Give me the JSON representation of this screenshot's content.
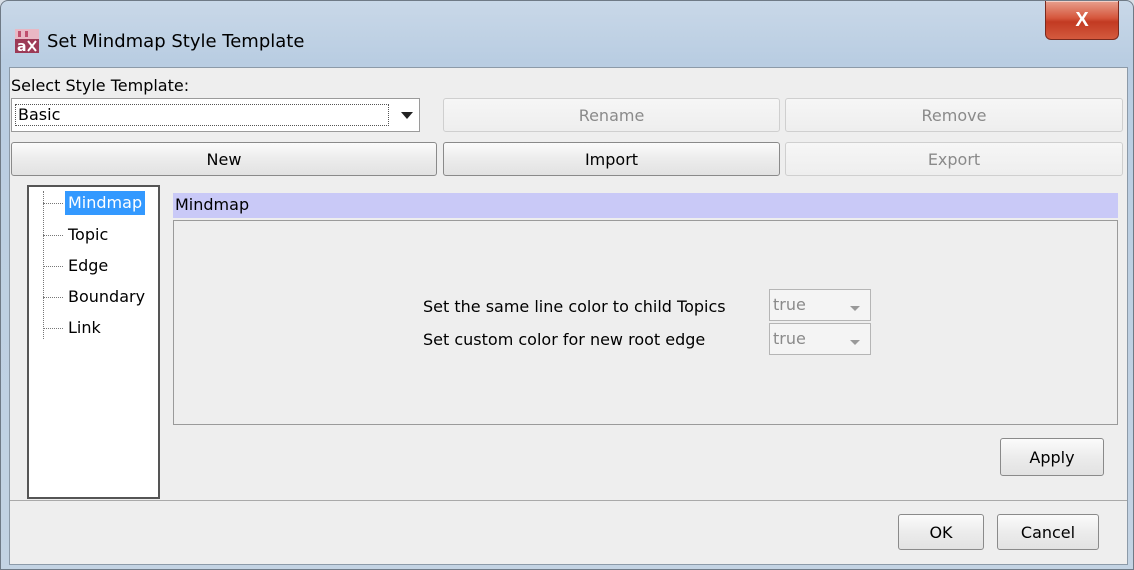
{
  "window": {
    "title": "Set Mindmap Style Template",
    "close_glyph": "X",
    "icon": "app-icon"
  },
  "template": {
    "label": "Select Style Template:",
    "selected": "Basic",
    "rename_label": "Rename",
    "remove_label": "Remove",
    "new_label": "New",
    "import_label": "Import",
    "export_label": "Export"
  },
  "tree": {
    "items": [
      "Mindmap",
      "Topic",
      "Edge",
      "Boundary",
      "Link"
    ],
    "selected_index": 0
  },
  "panel": {
    "header": "Mindmap",
    "properties": [
      {
        "label": "Set the same line color to child Topics",
        "value": "true"
      },
      {
        "label": "Set custom color for new root edge",
        "value": "true"
      }
    ],
    "apply_label": "Apply"
  },
  "footer": {
    "ok_label": "OK",
    "cancel_label": "Cancel"
  },
  "colors": {
    "selection": "#3399ff",
    "header_bg": "#c9c9f7",
    "close_red": "#c23a22"
  }
}
